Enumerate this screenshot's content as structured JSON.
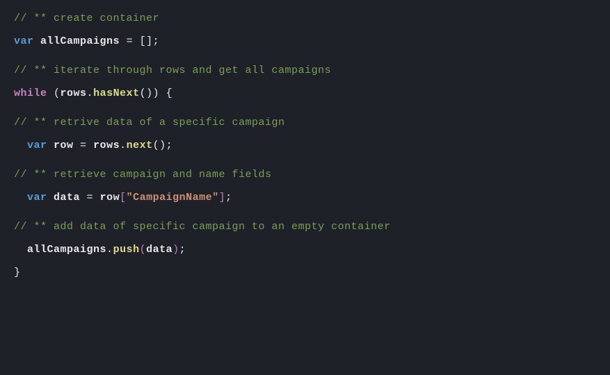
{
  "code": {
    "comment1": "// ** create container",
    "line2_var": "var",
    "line2_ident": "allCampaigns",
    "line2_rest": " = [];",
    "comment3": "// ** iterate through rows and get all campaigns",
    "line4_while": "while",
    "line4_open": " (",
    "line4_rows": "rows",
    "line4_dot": ".",
    "line4_method": "hasNext",
    "line4_close": "()) {",
    "comment5": "// ** retrive data of a specific campaign",
    "line6_indent": "  ",
    "line6_var": "var",
    "line6_ident": " row",
    "line6_eq": " = ",
    "line6_rows": "rows",
    "line6_dot": ".",
    "line6_method": "next",
    "line6_close": "();",
    "comment7": "// ** retrieve campaign and name fields",
    "line8_indent": "  ",
    "line8_var": "var",
    "line8_ident": " data",
    "line8_eq": " = ",
    "line8_row": "row",
    "line8_bopen": "[",
    "line8_str": "\"CampaignName\"",
    "line8_bclose": "]",
    "line8_semi": ";",
    "comment9": "// ** add data of specific campaign to an empty container",
    "line10_indent": "  ",
    "line10_ident": "allCampaigns",
    "line10_dot": ".",
    "line10_method": "push",
    "line10_popen": "(",
    "line10_arg": "data",
    "line10_pclose": ")",
    "line10_semi": ";",
    "line11_brace": "}"
  }
}
